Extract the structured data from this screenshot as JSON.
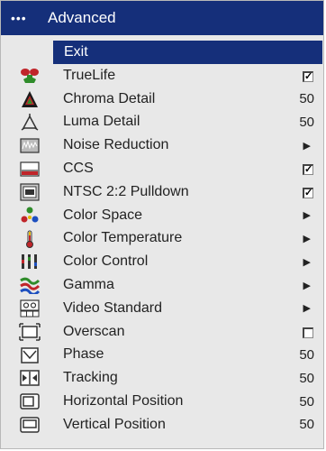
{
  "menu": {
    "title": "Advanced",
    "dots": "•••",
    "exit_label": "Exit",
    "items": [
      {
        "label": "TrueLife",
        "icon": "truelife-icon",
        "control": "checkbox",
        "value": "✓"
      },
      {
        "label": "Chroma Detail",
        "icon": "chroma-detail-icon",
        "control": "value",
        "value": "50"
      },
      {
        "label": "Luma Detail",
        "icon": "luma-detail-icon",
        "control": "value",
        "value": "50"
      },
      {
        "label": "Noise Reduction",
        "icon": "noise-reduction-icon",
        "control": "arrow",
        "value": "▶"
      },
      {
        "label": "CCS",
        "icon": "ccs-icon",
        "control": "checkbox",
        "value": "✓"
      },
      {
        "label": "NTSC 2:2 Pulldown",
        "icon": "pulldown-icon",
        "control": "checkbox",
        "value": "✓"
      },
      {
        "label": "Color Space",
        "icon": "color-space-icon",
        "control": "arrow",
        "value": "▶"
      },
      {
        "label": "Color Temperature",
        "icon": "thermometer-icon",
        "control": "arrow",
        "value": "▶"
      },
      {
        "label": "Color Control",
        "icon": "color-control-icon",
        "control": "arrow",
        "value": "▶"
      },
      {
        "label": "Gamma",
        "icon": "gamma-icon",
        "control": "arrow",
        "value": "▶"
      },
      {
        "label": "Video Standard",
        "icon": "video-standard-icon",
        "control": "arrow",
        "value": "▶"
      },
      {
        "label": "Overscan",
        "icon": "overscan-icon",
        "control": "checkbox",
        "value": ""
      },
      {
        "label": "Phase",
        "icon": "phase-icon",
        "control": "value",
        "value": "50"
      },
      {
        "label": "Tracking",
        "icon": "tracking-icon",
        "control": "value",
        "value": "50"
      },
      {
        "label": "Horizontal Position",
        "icon": "horizontal-position-icon",
        "control": "value",
        "value": "50"
      },
      {
        "label": "Vertical Position",
        "icon": "vertical-position-icon",
        "control": "value",
        "value": "50"
      }
    ]
  },
  "colors": {
    "title_bg": "#152f7a",
    "menu_bg": "#e8e8e8",
    "text": "#222222"
  }
}
